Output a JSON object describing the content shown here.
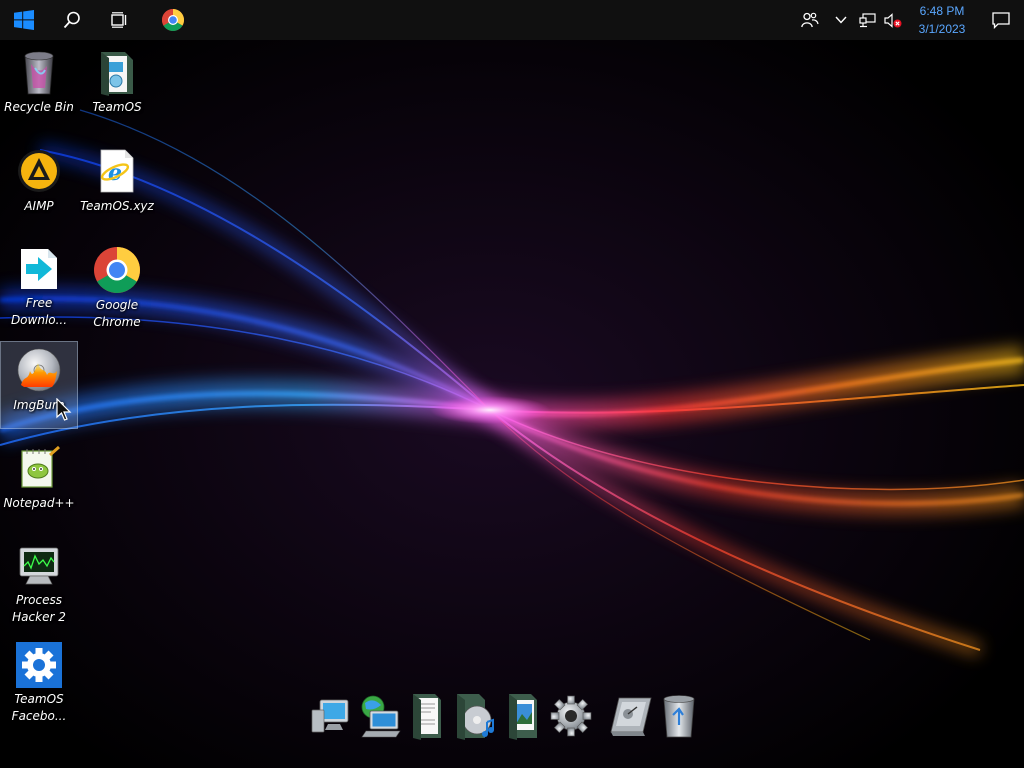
{
  "taskbar": {
    "start_icon": "windows-logo-icon",
    "search_icon": "search-icon",
    "task_view_icon": "task-view-icon",
    "pinned_app_icon": "chrome-icon",
    "tray": {
      "people_icon": "people-icon",
      "chevron_icon": "chevron-up-icon",
      "network_icon": "network-icon",
      "volume_icon": "volume-muted-icon",
      "time": "6:48 PM",
      "date": "3/1/2023",
      "notification_icon": "action-center-icon"
    }
  },
  "desktop": {
    "icons": [
      {
        "label": "Recycle Bin",
        "icon": "recycle-bin-icon"
      },
      {
        "label": "TeamOS",
        "icon": "folder-icon"
      },
      {
        "label": "AIMP",
        "icon": "aimp-icon"
      },
      {
        "label": "TeamOS.xyz",
        "icon": "internet-explorer-icon"
      },
      {
        "label": "Free Downlo...",
        "icon": "free-download-manager-icon"
      },
      {
        "label": "Google Chrome",
        "icon": "chrome-icon"
      },
      {
        "label": "ImgBurn",
        "icon": "imgburn-icon"
      },
      {
        "label": "Notepad++",
        "icon": "notepad-plus-plus-icon"
      },
      {
        "label": "Process Hacker 2",
        "icon": "process-hacker-icon"
      },
      {
        "label": "TeamOS Facebo...",
        "icon": "gear-icon"
      }
    ],
    "selected_icon": "ImgBurn"
  },
  "dock": {
    "items": [
      {
        "icon": "computer-icon"
      },
      {
        "icon": "network-globe-icon"
      },
      {
        "icon": "documents-folder-icon"
      },
      {
        "icon": "music-folder-icon"
      },
      {
        "icon": "pictures-folder-icon"
      },
      {
        "icon": "settings-gear-icon"
      },
      {
        "icon": "control-panel-icon"
      },
      {
        "icon": "recycle-bin-icon"
      }
    ]
  },
  "colors": {
    "taskbar": "#101010",
    "clock_text": "#5aa7ff",
    "windows_blue": "#1a8cff"
  }
}
